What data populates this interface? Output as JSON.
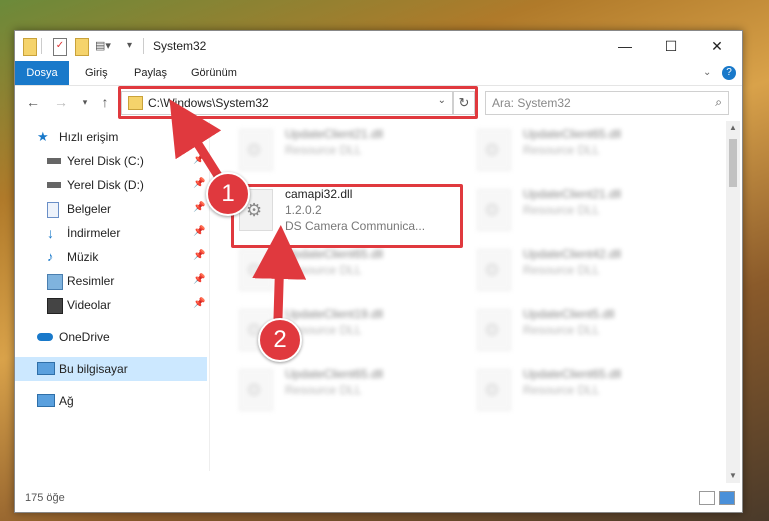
{
  "window": {
    "title": "System32"
  },
  "ribbon": {
    "tabs": [
      "Dosya",
      "Giriş",
      "Paylaş",
      "Görünüm"
    ]
  },
  "nav": {
    "address": "C:\\Windows\\System32",
    "search_placeholder": "Ara: System32"
  },
  "sidebar": {
    "items": [
      {
        "label": "Hızlı erişim",
        "icon": "star-icon"
      },
      {
        "label": "Yerel Disk (C:)",
        "icon": "drive-icon"
      },
      {
        "label": "Yerel Disk (D:)",
        "icon": "drive-icon"
      },
      {
        "label": "Belgeler",
        "icon": "document-icon"
      },
      {
        "label": "İndirmeler",
        "icon": "download-icon"
      },
      {
        "label": "Müzik",
        "icon": "music-icon"
      },
      {
        "label": "Resimler",
        "icon": "pictures-icon"
      },
      {
        "label": "Videolar",
        "icon": "video-icon"
      },
      {
        "label": "OneDrive",
        "icon": "cloud-icon"
      },
      {
        "label": "Bu bilgisayar",
        "icon": "computer-icon"
      },
      {
        "label": "Ağ",
        "icon": "network-icon"
      }
    ]
  },
  "files": [
    {
      "name": "UpdateClient21.dll",
      "type": "Resource DLL"
    },
    {
      "name": "UpdateClient65.dll",
      "type": "Resource DLL"
    },
    {
      "name": "UpdateClient21.dll",
      "type": "Resource DLL"
    },
    {
      "name": "UpdateClient65.dll",
      "type": "Resource DLL"
    },
    {
      "name": "UpdateClient42.dll",
      "type": "Resource DLL"
    },
    {
      "name": "UpdateClient19.dll",
      "type": "Resource DLL"
    },
    {
      "name": "UpdateClient5.dll",
      "type": "Resource DLL"
    },
    {
      "name": "UpdateClient65.dll",
      "type": "Resource DLL"
    },
    {
      "name": "UpdateClient65.dll",
      "type": "Resource DLL"
    }
  ],
  "highlighted_file": {
    "name": "camapi32.dll",
    "version": "1.2.0.2",
    "description": "DS Camera Communica..."
  },
  "status": {
    "count": "175 öğe"
  },
  "annotations": {
    "badge1": "1",
    "badge2": "2",
    "color": "#e0393e"
  }
}
